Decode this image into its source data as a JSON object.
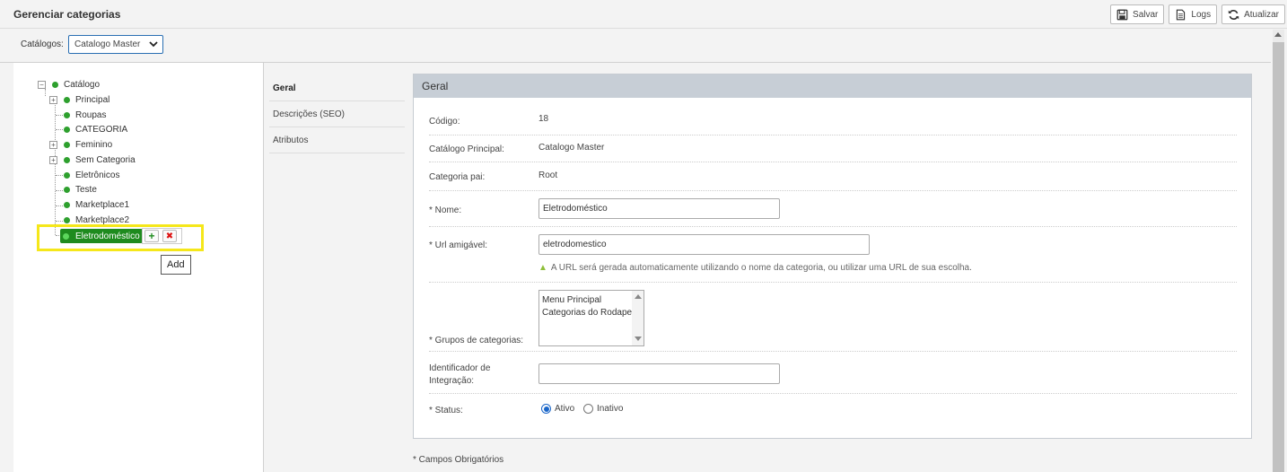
{
  "header": {
    "title": "Gerenciar categorias",
    "buttons": {
      "save": "Salvar",
      "logs": "Logs",
      "refresh": "Atualizar"
    }
  },
  "catalog": {
    "label": "Catálogos:",
    "selected": "Catalogo Master"
  },
  "tree": {
    "root": "Catálogo",
    "items": [
      "Principal",
      "Roupas",
      "CATEGORIA",
      "Feminino",
      "Sem Categoria",
      "Eletrônicos",
      "Teste",
      "Marketplace1",
      "Marketplace2"
    ],
    "selected": "Eletrodoméstico",
    "tooltip": "Add"
  },
  "tabs": [
    "Geral",
    "Descrições (SEO)",
    "Atributos"
  ],
  "form": {
    "title": "Geral",
    "codigo_label": "Código:",
    "codigo_value": "18",
    "catalogo_label": "Catálogo Principal:",
    "catalogo_value": "Catalogo Master",
    "pai_label": "Categoria pai:",
    "pai_value": "Root",
    "nome_label": "* Nome:",
    "nome_value": "Eletrodoméstico",
    "url_label": "* Url amigável:",
    "url_value": "eletrodomestico",
    "url_hint": "A URL será gerada automaticamente utilizando o nome da categoria, ou utilizar uma URL de sua escolha.",
    "grupos_label": "* Grupos de categorias:",
    "grupos_options": [
      "Menu Principal",
      "Categorias do Rodape"
    ],
    "integracao_label_1": "Identificador de",
    "integracao_label_2": "Integração:",
    "integracao_value": "",
    "status_label": "* Status:",
    "status_active": "Ativo",
    "status_inactive": "Inativo",
    "status_value": "Ativo"
  },
  "footnote": "* Campos Obrigatórios",
  "colors": {
    "selected_node": "#1e8b1e",
    "highlight": "#f5e71a",
    "form_header": "#c7ced6",
    "radio_accent": "#1a66c9"
  }
}
